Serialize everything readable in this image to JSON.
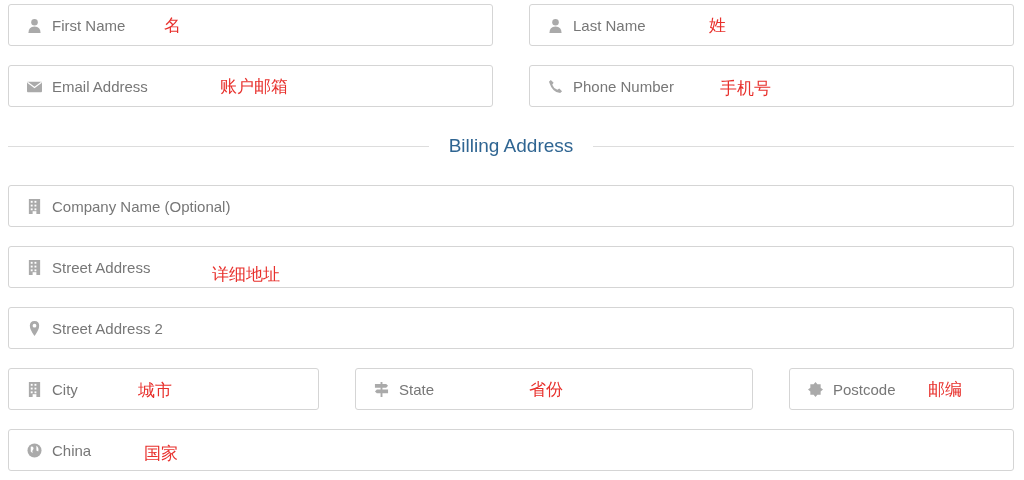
{
  "contact_rows": [
    {
      "fields": [
        {
          "kind": "person",
          "placeholder": "First Name",
          "annotation": "名"
        },
        {
          "kind": "person",
          "placeholder": "Last Name",
          "annotation": "姓"
        }
      ]
    },
    {
      "fields": [
        {
          "kind": "envelope",
          "placeholder": "Email Address",
          "annotation": "账户邮箱"
        },
        {
          "kind": "phone",
          "placeholder": "Phone Number",
          "annotation": "手机号"
        }
      ]
    }
  ],
  "section_title": "Billing Address",
  "address_rows": [
    {
      "fields": [
        {
          "kind": "building",
          "placeholder": "Company Name (Optional)"
        }
      ]
    },
    {
      "fields": [
        {
          "kind": "building",
          "placeholder": "Street Address",
          "annotation": "详细地址"
        }
      ]
    },
    {
      "fields": [
        {
          "kind": "pin",
          "placeholder": "Street Address 2"
        }
      ]
    },
    {
      "fields": [
        {
          "kind": "building",
          "placeholder": "City",
          "annotation": "城市"
        },
        {
          "kind": "signpost",
          "placeholder": "State",
          "annotation": "省份"
        },
        {
          "kind": "badge",
          "placeholder": "Postcode",
          "annotation": "邮编"
        }
      ]
    },
    {
      "fields": [
        {
          "kind": "globe",
          "placeholder": "China",
          "annotation": "国家"
        }
      ]
    }
  ]
}
